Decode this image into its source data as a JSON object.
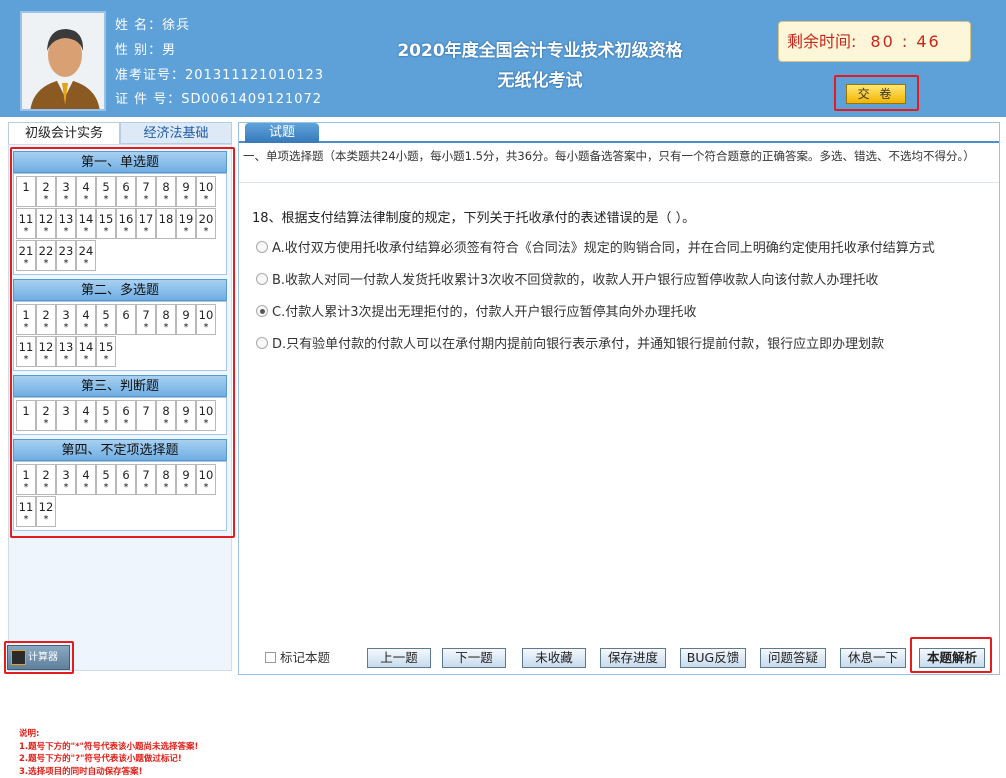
{
  "header": {
    "name_label": "姓    名：",
    "name": "徐兵",
    "gender_label": "性    别：",
    "gender": "男",
    "ticket_label": "准考证号：",
    "ticket": "201311121010123",
    "id_label": "证 件 号：",
    "id": "SD0061409121072",
    "title_line1": "2020年度全国会计专业技术初级资格",
    "title_line2": "无纸化考试",
    "timer_label": "剩余时间:",
    "timer_value": "80 : 46",
    "submit_label": "交 卷"
  },
  "subject_tabs": [
    {
      "label": "初级会计实务",
      "active": true
    },
    {
      "label": "经济法基础",
      "active": false
    }
  ],
  "sections": [
    {
      "title": "第一、单选题",
      "items": [
        {
          "n": "1",
          "s": ""
        },
        {
          "n": "2",
          "s": "*"
        },
        {
          "n": "3",
          "s": "*"
        },
        {
          "n": "4",
          "s": "*"
        },
        {
          "n": "5",
          "s": "*"
        },
        {
          "n": "6",
          "s": "*"
        },
        {
          "n": "7",
          "s": "*"
        },
        {
          "n": "8",
          "s": "*"
        },
        {
          "n": "9",
          "s": "*"
        },
        {
          "n": "10",
          "s": "*"
        },
        {
          "n": "11",
          "s": "*"
        },
        {
          "n": "12",
          "s": "*"
        },
        {
          "n": "13",
          "s": "*"
        },
        {
          "n": "14",
          "s": "*"
        },
        {
          "n": "15",
          "s": "*"
        },
        {
          "n": "16",
          "s": "*"
        },
        {
          "n": "17",
          "s": "*"
        },
        {
          "n": "18",
          "s": ""
        },
        {
          "n": "19",
          "s": "*"
        },
        {
          "n": "20",
          "s": "*"
        },
        {
          "n": "21",
          "s": "*"
        },
        {
          "n": "22",
          "s": "*"
        },
        {
          "n": "23",
          "s": "*"
        },
        {
          "n": "24",
          "s": "*"
        }
      ]
    },
    {
      "title": "第二、多选题",
      "items": [
        {
          "n": "1",
          "s": "*"
        },
        {
          "n": "2",
          "s": "*"
        },
        {
          "n": "3",
          "s": "*"
        },
        {
          "n": "4",
          "s": "*"
        },
        {
          "n": "5",
          "s": "*"
        },
        {
          "n": "6",
          "s": ""
        },
        {
          "n": "7",
          "s": "*"
        },
        {
          "n": "8",
          "s": "*"
        },
        {
          "n": "9",
          "s": "*"
        },
        {
          "n": "10",
          "s": "*"
        },
        {
          "n": "11",
          "s": "*"
        },
        {
          "n": "12",
          "s": "*"
        },
        {
          "n": "13",
          "s": "*"
        },
        {
          "n": "14",
          "s": "*"
        },
        {
          "n": "15",
          "s": "*"
        }
      ]
    },
    {
      "title": "第三、判断题",
      "items": [
        {
          "n": "1",
          "s": ""
        },
        {
          "n": "2",
          "s": "*"
        },
        {
          "n": "3",
          "s": ""
        },
        {
          "n": "4",
          "s": "*"
        },
        {
          "n": "5",
          "s": "*"
        },
        {
          "n": "6",
          "s": "*"
        },
        {
          "n": "7",
          "s": ""
        },
        {
          "n": "8",
          "s": "*"
        },
        {
          "n": "9",
          "s": "*"
        },
        {
          "n": "10",
          "s": "*"
        }
      ]
    },
    {
      "title": "第四、不定项选择题",
      "items": [
        {
          "n": "1",
          "s": "*"
        },
        {
          "n": "2",
          "s": "*"
        },
        {
          "n": "3",
          "s": "*"
        },
        {
          "n": "4",
          "s": "*"
        },
        {
          "n": "5",
          "s": "*"
        },
        {
          "n": "6",
          "s": "*"
        },
        {
          "n": "7",
          "s": "*"
        },
        {
          "n": "8",
          "s": "*"
        },
        {
          "n": "9",
          "s": "*"
        },
        {
          "n": "10",
          "s": "*"
        },
        {
          "n": "11",
          "s": "*"
        },
        {
          "n": "12",
          "s": "*"
        }
      ]
    }
  ],
  "legend": {
    "title": "说明:",
    "line1": "1.题号下方的\"*\"符号代表该小题尚未选择答案!",
    "line2": "2.题号下方的\"?\"符号代表该小题做过标记!",
    "line3": "3.选择项目的同时自动保存答案!"
  },
  "calculator_label": "计算器",
  "main": {
    "tab_label": "试题",
    "section_desc": "一、单项选择题（本类题共24小题，每小题1.5分，共36分。每小题备选答案中，只有一个符合题意的正确答案。多选、错选、不选均不得分。）",
    "question": "18、根据支付结算法律制度的规定，下列关于托收承付的表述错误的是（ ）。",
    "options": [
      {
        "text": "A.收付双方使用托收承付结算必须签有符合《合同法》规定的购销合同，并在合同上明确约定使用托收承付结算方式",
        "selected": false
      },
      {
        "text": "B.收款人对同一付款人发货托收累计3次收不回贷款的，收款人开户银行应暂停收款人向该付款人办理托收",
        "selected": false
      },
      {
        "text": "C.付款人累计3次提出无理拒付的，付款人开户银行应暂停其向外办理托收",
        "selected": true
      },
      {
        "text": "D.只有验单付款的付款人可以在承付期内提前向银行表示承付，并通知银行提前付款，银行应立即办理划款",
        "selected": false
      }
    ]
  },
  "bottom": {
    "mark_label": "标记本题",
    "prev": "上一题",
    "next": "下一题",
    "unfav": "未收藏",
    "save": "保存进度",
    "bug": "BUG反馈",
    "qa": "问题答疑",
    "rest": "休息一下",
    "analysis": "本题解析"
  },
  "colors": {
    "header_bg": "#5ea0d8",
    "highlight_red": "#e31d1d",
    "timer_text": "#c8281c"
  }
}
